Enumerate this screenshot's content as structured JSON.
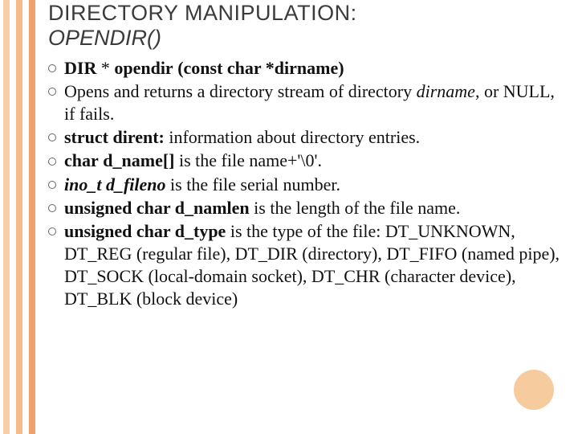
{
  "title": {
    "main": "DIRECTORY MANIPULATION:",
    "sub": "OPENDIR()"
  },
  "bullets": [
    {
      "b1": "DIR",
      "t1": " * ",
      "b2": "opendir",
      "t2": " ",
      "b3": "(const char *dirname)"
    },
    {
      "t1": "Opens and returns a directory stream of directory ",
      "i1": "dirname",
      "t2": ", or NULL, if fails."
    },
    {
      "b1": "struct",
      "t1": " ",
      "b2": "dirent:",
      "t2": " information about directory entries."
    },
    {
      "b1": "char",
      "t1": " ",
      "b2": "d_name[]",
      "t2": " is the file name+'\\0'."
    },
    {
      "bi1": "ino_t",
      "t1": " ",
      "bi2": "d_fileno",
      "t2": "  is the file serial number."
    },
    {
      "b1": "unsigned",
      "t1": " ",
      "b2": "char d_namlen",
      "t2": " is the length of the file name."
    },
    {
      "b1": "unsigned",
      "t1": " ",
      "b2": "char d_type",
      "t2": "  is the type of the file: DT_UNKNOWN, DT_REG (regular file), DT_DIR (directory), DT_FIFO (named pipe), DT_SOCK (local-domain socket), DT_CHR (character device), DT_BLK (block device)"
    }
  ]
}
